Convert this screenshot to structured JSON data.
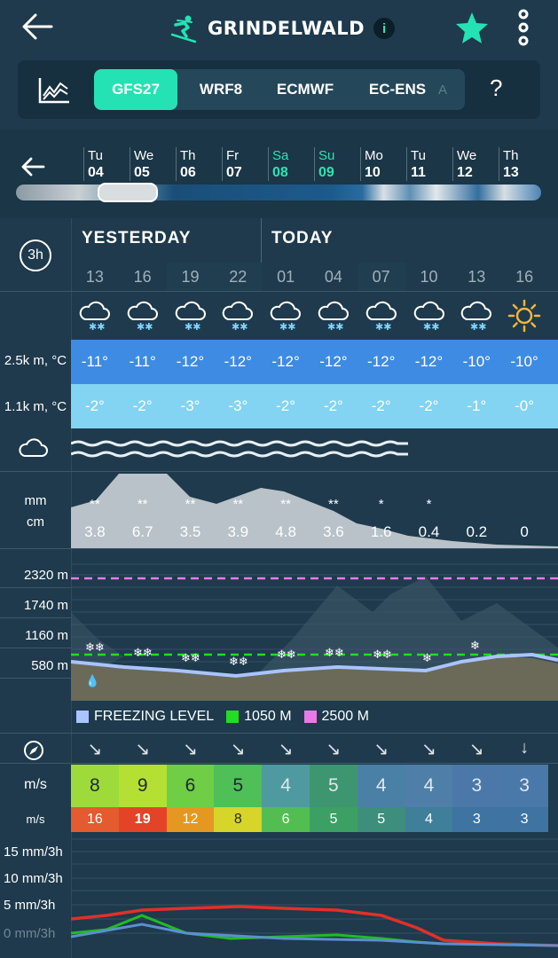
{
  "header": {
    "title": "GRINDELWALD",
    "info_label": "i",
    "icons": [
      "back-arrow-icon",
      "skier-icon",
      "info-icon",
      "favorite-star-icon",
      "more-vert-icon"
    ],
    "accent": "#24e2b3"
  },
  "models": {
    "tabs": [
      "GFS27",
      "WRF8",
      "ECMWF",
      "EC-ENS",
      "A"
    ],
    "active": "GFS27",
    "help_label": "?"
  },
  "days": [
    {
      "dow": "Tu",
      "num": "04",
      "weekend": false
    },
    {
      "dow": "We",
      "num": "05",
      "weekend": false
    },
    {
      "dow": "Th",
      "num": "06",
      "weekend": false
    },
    {
      "dow": "Fr",
      "num": "07",
      "weekend": false
    },
    {
      "dow": "Sa",
      "num": "08",
      "weekend": true
    },
    {
      "dow": "Su",
      "num": "09",
      "weekend": true
    },
    {
      "dow": "Mo",
      "num": "10",
      "weekend": false
    },
    {
      "dow": "Tu",
      "num": "11",
      "weekend": false
    },
    {
      "dow": "We",
      "num": "12",
      "weekend": false
    },
    {
      "dow": "Th",
      "num": "13",
      "weekend": false
    }
  ],
  "interval_label": "3h",
  "day_headers": {
    "yesterday": "YESTERDAY",
    "today": "TODAY"
  },
  "hours": [
    "13",
    "16",
    "19",
    "22",
    "01",
    "04",
    "07",
    "10",
    "13",
    "16"
  ],
  "weather_icons": [
    "snow-cloud-icon",
    "snow-cloud-icon",
    "snow-cloud-icon",
    "snow-cloud-icon",
    "snow-cloud-icon",
    "snow-cloud-icon",
    "snow-cloud-icon",
    "snow-cloud-icon",
    "snow-cloud-icon",
    "sun-icon"
  ],
  "temps": {
    "label_2500": "2.5k m, °C",
    "label_1100": "1.1k m, °C",
    "t2500": [
      "-11°",
      "-11°",
      "-12°",
      "-12°",
      "-12°",
      "-12°",
      "-12°",
      "-12°",
      "-10°",
      "-10°"
    ],
    "t1100": [
      "-2°",
      "-2°",
      "-3°",
      "-3°",
      "-2°",
      "-2°",
      "-2°",
      "-2°",
      "-1°",
      "-0°"
    ]
  },
  "precip": {
    "unit_mm": "mm",
    "unit_cm": "cm",
    "values": [
      "3.8",
      "6.7",
      "3.5",
      "3.9",
      "4.8",
      "3.6",
      "1.6",
      "0.4",
      "0.2",
      "0"
    ],
    "snow_marks": [
      "**",
      "**",
      "**",
      "**",
      "**",
      "**",
      "*",
      "*",
      "",
      ""
    ]
  },
  "altitudes": {
    "labels": [
      "2320 m",
      "1740 m",
      "1160 m",
      "580 m"
    ]
  },
  "legend": {
    "freezing": "FREEZING LEVEL",
    "green": "1050 M",
    "magenta": "2500 M",
    "colors": {
      "freezing": "#a9c4ff",
      "green": "#22dd22",
      "magenta": "#e87ae8"
    }
  },
  "wind": {
    "unit": "m/s",
    "gust_unit": "m/s",
    "directions": [
      "↘",
      "↘",
      "↘",
      "↘",
      "↘",
      "↘",
      "↘",
      "↘",
      "↘",
      "↓"
    ],
    "speeds": [
      "8",
      "9",
      "6",
      "5",
      "4",
      "5",
      "4",
      "4",
      "3",
      "3"
    ],
    "gusts": [
      "16",
      "19",
      "12",
      "8",
      "6",
      "5",
      "5",
      "4",
      "3",
      "3"
    ]
  },
  "rain": {
    "labels": [
      "15 mm/3h",
      "10 mm/3h",
      "5 mm/3h",
      "0 mm/3h"
    ]
  }
}
